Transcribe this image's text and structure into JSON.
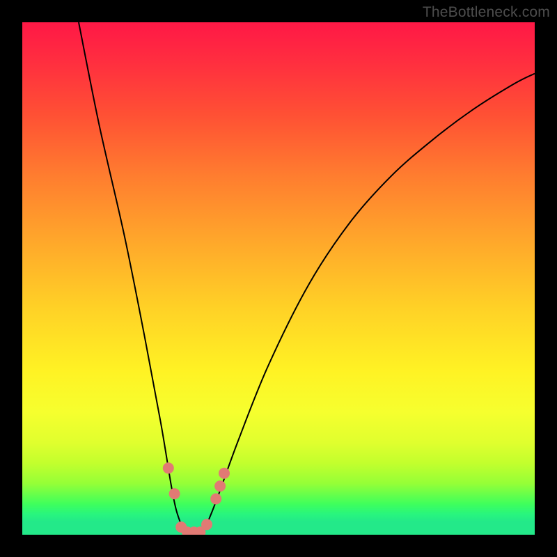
{
  "watermark": "TheBottleneck.com",
  "chart_data": {
    "type": "line",
    "title": "",
    "xlabel": "",
    "ylabel": "",
    "xlim": [
      0,
      100
    ],
    "ylim": [
      0,
      100
    ],
    "series": [
      {
        "name": "curve",
        "x": [
          11,
          15,
          20,
          24,
          27,
          29,
          30,
          31,
          32,
          33,
          34,
          35,
          36,
          38,
          42,
          48,
          56,
          64,
          72,
          80,
          88,
          96,
          100
        ],
        "values": [
          100,
          80,
          58,
          38,
          22,
          10,
          5,
          2,
          0,
          0,
          0,
          0,
          2,
          7,
          18,
          33,
          49,
          61,
          70,
          77,
          83,
          88,
          90
        ]
      }
    ],
    "markers": [
      {
        "x": 28.5,
        "y": 13
      },
      {
        "x": 29.7,
        "y": 8
      },
      {
        "x": 31.0,
        "y": 1.5
      },
      {
        "x": 32.2,
        "y": 0.5
      },
      {
        "x": 33.5,
        "y": 0.5
      },
      {
        "x": 34.7,
        "y": 0.5
      },
      {
        "x": 36.0,
        "y": 2
      },
      {
        "x": 37.8,
        "y": 7
      },
      {
        "x": 38.6,
        "y": 9.5
      },
      {
        "x": 39.4,
        "y": 12
      }
    ],
    "colors": {
      "curve_stroke": "#000000",
      "marker_fill": "#e17a74"
    }
  }
}
